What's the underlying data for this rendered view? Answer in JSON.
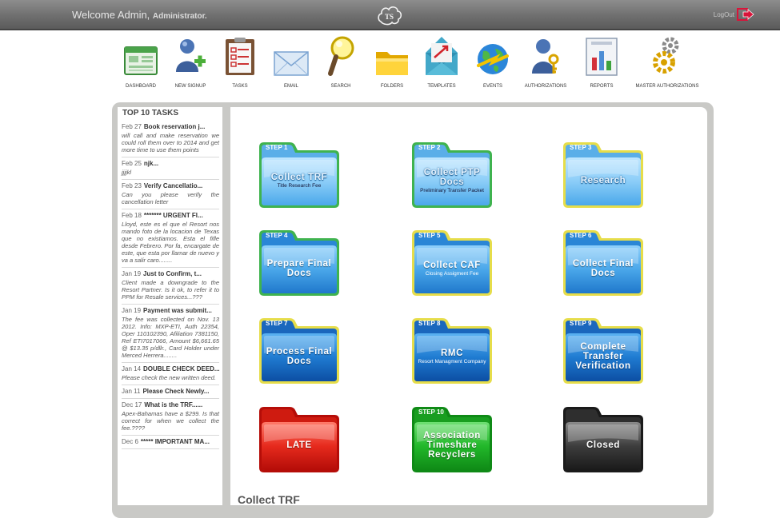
{
  "header": {
    "welcome": "Welcome Admin,",
    "role": "Administrator.",
    "logout": "LogOut"
  },
  "nav": [
    {
      "label": "DASHBOARD",
      "icon": "dashboard-icon"
    },
    {
      "label": "NEW SIGNUP",
      "icon": "new-signup-icon"
    },
    {
      "label": "TASKS",
      "icon": "clipboard-icon"
    },
    {
      "label": "EMAIL",
      "icon": "envelope-icon"
    },
    {
      "label": "SEARCH",
      "icon": "magnifier-icon"
    },
    {
      "label": "FOLDERS",
      "icon": "folder-icon"
    },
    {
      "label": "TEMPLATES",
      "icon": "templates-icon"
    },
    {
      "label": "EVENTS",
      "icon": "globe-icon"
    },
    {
      "label": "AUTHORIZATIONS",
      "icon": "user-key-icon"
    },
    {
      "label": "REPORTS",
      "icon": "report-chart-icon"
    },
    {
      "label": "MASTER AUTHORIZATIONS",
      "icon": "gears-icon"
    }
  ],
  "tasks": {
    "title": "TOP 10 TASKS",
    "items": [
      {
        "date": "Feb 27",
        "title": "Book reservation j...",
        "body": "will call and make reservation we could roll them over to 2014 and get more time to use them points"
      },
      {
        "date": "Feb 25",
        "title": "njk...",
        "body": "jjjjkl"
      },
      {
        "date": "Feb 23",
        "title": "Verify Cancellatio...",
        "body": "Can you please verify the cancellation letter"
      },
      {
        "date": "Feb 18",
        "title": "******* URGENT FI...",
        "body": "Lloyd, este es el que el Resort nos mando foto de la locacion de Texas que no existiamos. Esta el fifle desde Febrero. Por fa, encargate de este, que esta por llamar de nuevo y va a salir caro........"
      },
      {
        "date": "Jan 19",
        "title": "Just to Confirm, t...",
        "body": "Client made a downgrade to the Resort Partner. Is it ok, to refer it to PPM for Resale services...???"
      },
      {
        "date": "Jan 19",
        "title": "Payment was submit...",
        "body": "The fee was collected on Nov. 13 2012. Info: MXP-ETI, Auth 22354, Oper 110102390, Afiliation 7381150, Ref ETI7017066, Amount $6,661.65 @ $13.35 p/dllr., Card Holder under Merced Herrera........"
      },
      {
        "date": "Jan 14",
        "title": "DOUBLE CHECK DEED....",
        "body": "Please check the new written deed."
      },
      {
        "date": "Jan 11",
        "title": "Please Check Newly...",
        "body": ""
      },
      {
        "date": "Dec 17",
        "title": "What is the TRF......",
        "body": "Apex-Bahamas have a $299. Is that correct for when we collect the fee.????"
      },
      {
        "date": "Dec 6",
        "title": "***** IMPORTANT MA...",
        "body": ""
      }
    ]
  },
  "folders": [
    {
      "step": "STEP 1",
      "line1": "Collect TRF",
      "line2": "Title Research Fee",
      "color": "light-blue",
      "border": "#3fb34f"
    },
    {
      "step": "STEP 2",
      "line1": "Collect PTP Docs",
      "line2": "Preliminary Transfer Packet",
      "color": "light-blue",
      "border": "#3fb34f"
    },
    {
      "step": "STEP 3",
      "line1": "Research",
      "line2": "",
      "color": "light-blue",
      "border": "#e6dd4a"
    },
    {
      "step": "STEP 4",
      "line1": "Prepare Final Docs",
      "line2": "",
      "color": "mid-blue",
      "border": "#3fb34f"
    },
    {
      "step": "STEP 5",
      "line1": "Collect CAF",
      "line2": "Closing Assigment Fee",
      "color": "mid-blue",
      "border": "#e6dd4a"
    },
    {
      "step": "STEP 6",
      "line1": "Collect Final Docs",
      "line2": "",
      "color": "mid-blue",
      "border": "#e6dd4a"
    },
    {
      "step": "STEP 7",
      "line1": "Process Final Docs",
      "line2": "",
      "color": "dark-blue",
      "border": "#e6dd4a"
    },
    {
      "step": "STEP 8",
      "line1": "RMC",
      "line2": "Resort Managment Company",
      "color": "dark-blue",
      "border": "#e6dd4a"
    },
    {
      "step": "STEP 9",
      "line1": "Complete Transfer Verification",
      "line2": "",
      "color": "dark-blue",
      "border": "#e6dd4a"
    },
    {
      "step": "",
      "line1": "LATE",
      "line2": "",
      "color": "red",
      "border": "none"
    },
    {
      "step": "STEP 10",
      "line1": "Association Timeshare Recyclers",
      "line2": "",
      "color": "green",
      "border": "none"
    },
    {
      "step": "",
      "line1": "Closed",
      "line2": "",
      "color": "black",
      "border": "none"
    }
  ],
  "section_title": "Collect TRF",
  "colors": {
    "header_bg": "#6f6f6f",
    "frame_bg": "#c9c9c6",
    "logout_red": "#d9143a"
  }
}
